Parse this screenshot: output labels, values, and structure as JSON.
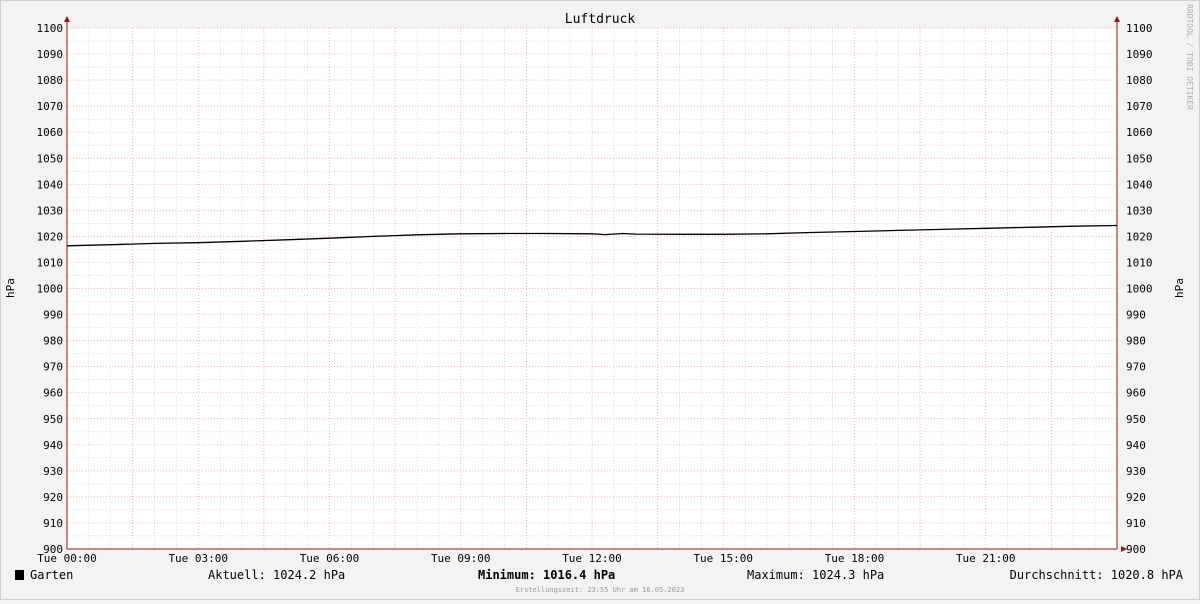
{
  "watermark": "RRDTOOL / TOBI OETIKER",
  "footer": {
    "series_label": "Garten",
    "current": "Aktuell: 1024.2 hPa",
    "minimum": "Minimum: 1016.4 hPa",
    "maximum": "Maximum: 1024.3 hPa",
    "average": "Durchschnitt: 1020.8 hPA",
    "created": "Erstellungszeit: 23:55 Uhr am 16.05.2023"
  },
  "colors": {
    "background": "#f3f3f3",
    "canvas": "#ffffff",
    "grid_major": "#e6a0a0",
    "grid_minor": "#c8c8c8",
    "axis": "#8b1a1a",
    "line": "#000000"
  },
  "chart_data": {
    "type": "line",
    "title": "Luftdruck",
    "ylabel": "hPa",
    "ylabel_right": "hPa",
    "ylim": [
      900,
      1100
    ],
    "ytick_step": 10,
    "xlim_hours": [
      0,
      24
    ],
    "xticks": [
      {
        "hour": 0,
        "label": "Tue 00:00"
      },
      {
        "hour": 3,
        "label": "Tue 03:00"
      },
      {
        "hour": 6,
        "label": "Tue 06:00"
      },
      {
        "hour": 9,
        "label": "Tue 09:00"
      },
      {
        "hour": 12,
        "label": "Tue 12:00"
      },
      {
        "hour": 15,
        "label": "Tue 15:00"
      },
      {
        "hour": 18,
        "label": "Tue 18:00"
      },
      {
        "hour": 21,
        "label": "Tue 21:00"
      }
    ],
    "series": [
      {
        "name": "Garten",
        "x_hours": [
          0,
          1,
          2,
          3,
          4,
          5,
          6,
          7,
          8,
          9,
          10,
          11,
          12,
          12.3,
          12.7,
          13,
          14,
          15,
          16,
          17,
          18,
          19,
          20,
          21,
          22,
          23,
          24
        ],
        "values": [
          1016.4,
          1016.8,
          1017.3,
          1017.6,
          1018.1,
          1018.7,
          1019.3,
          1020.0,
          1020.6,
          1021.0,
          1021.1,
          1021.1,
          1021.0,
          1020.7,
          1021.1,
          1020.9,
          1020.8,
          1020.8,
          1021.0,
          1021.5,
          1021.9,
          1022.3,
          1022.7,
          1023.1,
          1023.5,
          1023.9,
          1024.2
        ]
      }
    ],
    "grid": true
  }
}
